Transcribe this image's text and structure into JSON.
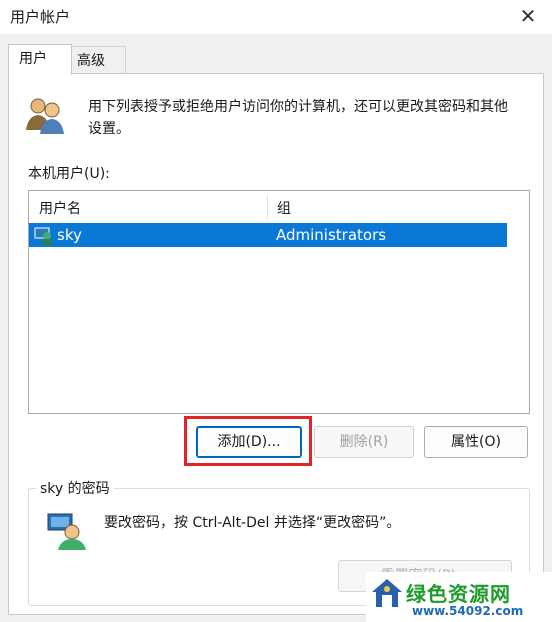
{
  "window": {
    "title": "用户帐户",
    "close_glyph": "✕"
  },
  "tabs": [
    {
      "label": "用户"
    },
    {
      "label": "高级"
    }
  ],
  "description": "用下列表授予或拒绝用户访问你的计算机，还可以更改其密码和其他设置。",
  "local_users": {
    "label": "本机用户(U):",
    "columns": [
      "用户名",
      "组"
    ],
    "rows": [
      {
        "username": "sky",
        "group": "Administrators",
        "selected": true
      }
    ]
  },
  "buttons": {
    "add": "添加(D)...",
    "remove": "删除(R)",
    "properties": "属性(O)"
  },
  "password_group": {
    "title": "sky 的密码",
    "text": "要改密码，按 Ctrl-Alt-Del 并选择“更改密码”。",
    "reset_button": "重置密码(P)..."
  },
  "watermark": {
    "name": "绿色资源网",
    "url": "www.54092.com"
  },
  "colors": {
    "selection": "#0a78d7",
    "highlight_box": "#e0252a",
    "watermark_green": "#1f9a2c"
  }
}
